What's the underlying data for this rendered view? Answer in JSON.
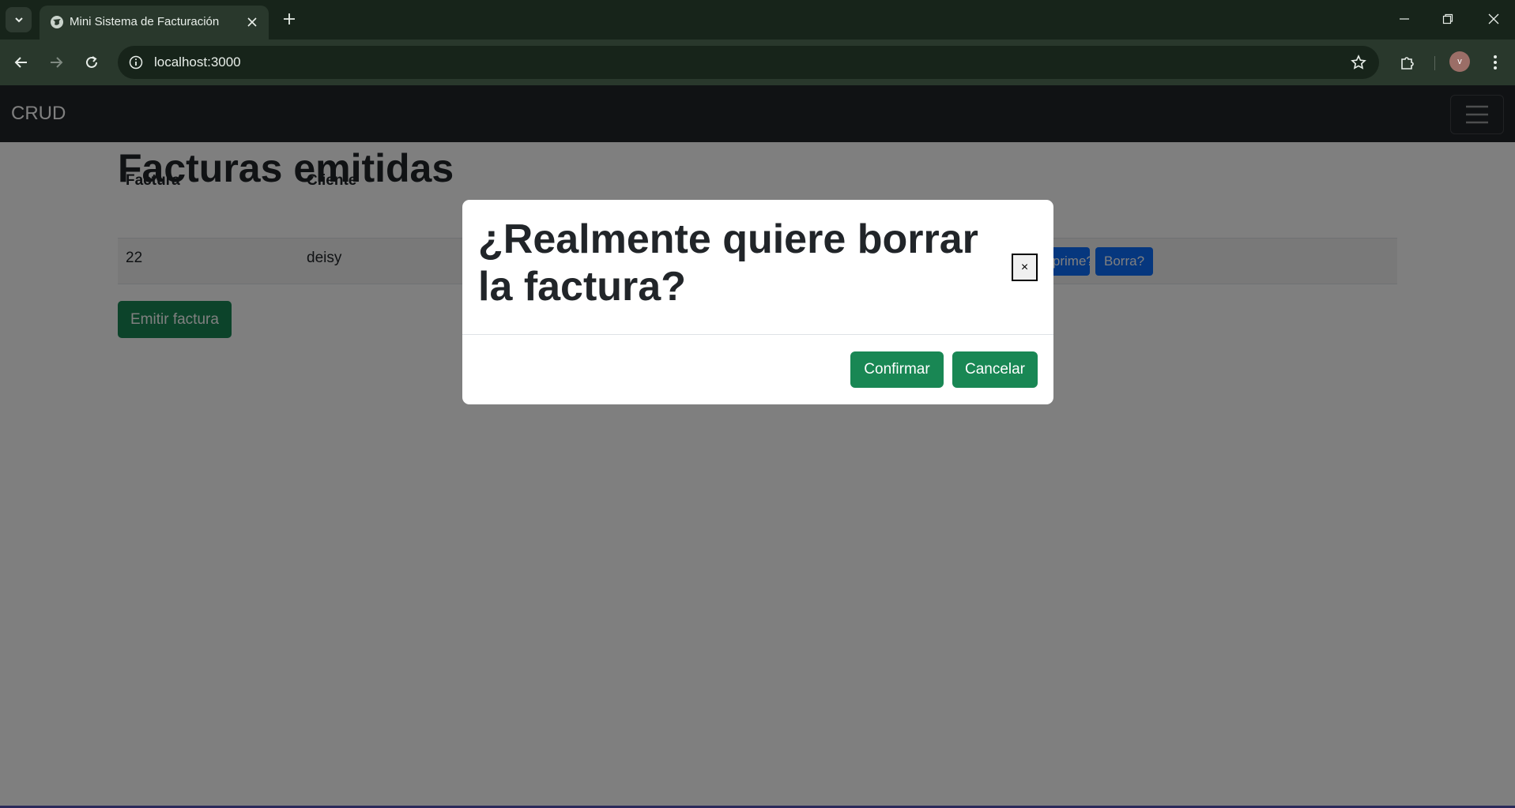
{
  "browser": {
    "tab_title": "Mini Sistema de Facturación",
    "url": "localhost:3000",
    "avatar_letter": "v"
  },
  "navbar": {
    "brand": "CRUD"
  },
  "main": {
    "title": "Facturas emitidas",
    "table": {
      "headers": [
        "Factura",
        "Cliente"
      ],
      "rows": [
        {
          "factura": "22",
          "cliente": "deisy",
          "print_label": "Imprime?",
          "delete_label": "Borra?"
        }
      ]
    },
    "emit_button": "Emitir factura"
  },
  "modal": {
    "title": "¿Realmente quiere borrar la factura?",
    "close_label": "×",
    "confirm_label": "Confirmar",
    "cancel_label": "Cancelar"
  },
  "colors": {
    "success": "#198754",
    "primary": "#0d6efd",
    "navbar": "#212529",
    "chrome": "#17241a"
  }
}
